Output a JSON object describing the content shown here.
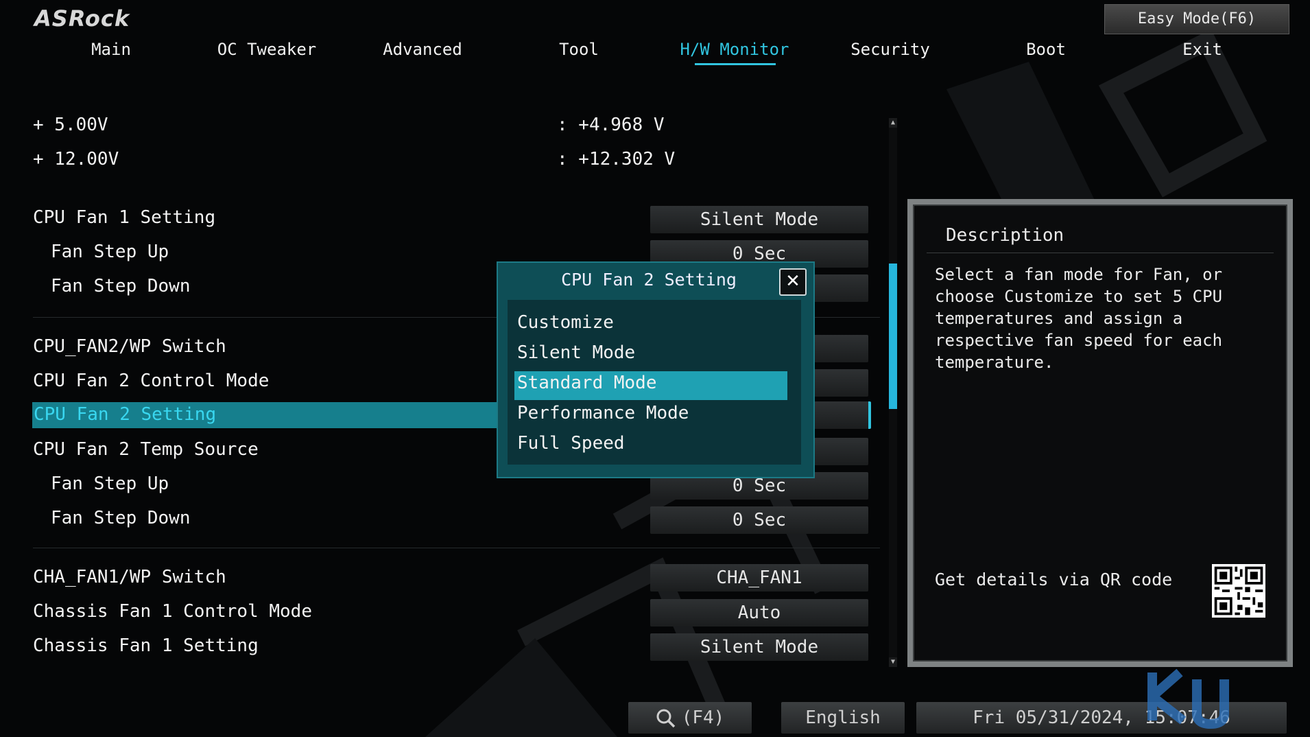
{
  "brand": {
    "logo": "ASRock"
  },
  "easy_mode": "Easy Mode(F6)",
  "nav": {
    "tabs": [
      "Main",
      "OC Tweaker",
      "Advanced",
      "Tool",
      "H/W Monitor",
      "Security",
      "Boot",
      "Exit"
    ],
    "active": "H/W Monitor"
  },
  "voltages": [
    {
      "label": "+ 5.00V",
      "value": ": +4.968 V"
    },
    {
      "label": "+ 12.00V",
      "value": ": +12.302 V"
    }
  ],
  "settings": {
    "cpu_fan1_setting": {
      "label": "CPU Fan 1 Setting",
      "value": "Silent Mode"
    },
    "cpu_fan1_step_up": {
      "label": "Fan Step Up",
      "value": "0 Sec"
    },
    "cpu_fan1_step_down": {
      "label": "Fan Step Down",
      "value": "0 Sec"
    },
    "cpu_fan2_switch": {
      "label": "CPU_FAN2/WP Switch"
    },
    "cpu_fan2_control_mode": {
      "label": "CPU Fan 2 Control Mode"
    },
    "cpu_fan2_setting": {
      "label": "CPU Fan 2 Setting"
    },
    "cpu_fan2_temp_source": {
      "label": "CPU Fan 2 Temp Source"
    },
    "cpu_fan2_step_up": {
      "label": "Fan Step Up",
      "value": "0 Sec"
    },
    "cpu_fan2_step_down": {
      "label": "Fan Step Down",
      "value": "0 Sec"
    },
    "cha_fan1_switch": {
      "label": "CHA_FAN1/WP Switch",
      "value": "CHA_FAN1"
    },
    "cha_fan1_control_mode": {
      "label": "Chassis Fan 1 Control Mode",
      "value": "Auto"
    },
    "cha_fan1_setting": {
      "label": "Chassis Fan 1 Setting",
      "value": "Silent Mode"
    }
  },
  "popup": {
    "title": "CPU Fan 2 Setting",
    "close_icon": "close-icon",
    "options": [
      "Customize",
      "Silent Mode",
      "Standard Mode",
      "Performance Mode",
      "Full Speed"
    ],
    "highlighted": "Standard Mode"
  },
  "description": {
    "title": "Description",
    "text": "Select a fan mode for Fan, or choose Customize to set 5 CPU temperatures and assign a respective fan speed for each temperature.",
    "qr_label": "Get details via QR code"
  },
  "bottom_bar": {
    "search_label": "(F4)",
    "language": "English",
    "datetime": "Fri 05/31/2024, 15:07:46"
  },
  "colors": {
    "accent": "#31c5e0",
    "selection": "#167f8d",
    "popup_bg": "#0e4e56",
    "highlight": "#1fa1b3"
  }
}
